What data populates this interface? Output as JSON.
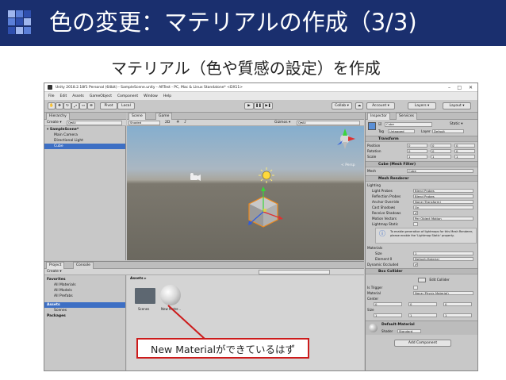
{
  "slide": {
    "title": "色の変更：マテリアルの作成（3/3)",
    "subtitle": "マテリアル（色や質感の設定）を作成",
    "callout": "New Materialができているはず"
  },
  "colors": {
    "header_bg": "#1a2f6e",
    "selection": "#3d6fc4",
    "callout_border": "#cc1b1b"
  },
  "window": {
    "title": "Unity 2018.2.18f1 Personal (64bit) - SampleScene.unity - ARTest - PC, Mac & Linux Standalone* <DX11>",
    "menu": [
      "File",
      "Edit",
      "Assets",
      "GameObject",
      "Component",
      "Window",
      "Help"
    ]
  },
  "toolbar": {
    "pivot": "Pivot",
    "local": "Local",
    "collab": "Collab ▾",
    "account": "Account ▾",
    "layers": "Layers ▾",
    "layout": "Layout ▾"
  },
  "hierarchy": {
    "tab": "Hierarchy",
    "create": "Create ▾",
    "search": "Q▾All",
    "scene": "SampleScene*",
    "items": [
      "Main Camera",
      "Directional Light",
      "Cube"
    ]
  },
  "scene": {
    "tabs": [
      "Scene",
      "Game"
    ],
    "shading": "Shaded",
    "mode2d": "2D",
    "gizmos": "Gizmos ▾",
    "search": "Q▾All",
    "persp": "< Persp"
  },
  "inspector": {
    "tabs": [
      "Inspector",
      "Services"
    ],
    "name": "Cube",
    "static_label": "Static ▾",
    "tag_label": "Tag",
    "tag_value": "Untagged",
    "layer_label": "Layer",
    "layer_value": "Default",
    "transform": {
      "title": "Transform",
      "rows": [
        {
          "label": "Position",
          "x": "0",
          "y": "0",
          "z": "0"
        },
        {
          "label": "Rotation",
          "x": "0",
          "y": "0",
          "z": "0"
        },
        {
          "label": "Scale",
          "x": "1",
          "y": "1",
          "z": "1"
        }
      ]
    },
    "mesh_filter": {
      "title": "Cube (Mesh Filter)",
      "label": "Mesh",
      "value": "Cube"
    },
    "mesh_renderer": {
      "title": "Mesh Renderer",
      "lighting": "Lighting",
      "rows": [
        {
          "label": "Light Probes",
          "value": "Blend Probes"
        },
        {
          "label": "Reflection Probes",
          "value": "Blend Probes"
        },
        {
          "label": "Anchor Override",
          "value": "None (Transform)"
        },
        {
          "label": "Cast Shadows",
          "value": "On"
        },
        {
          "label": "Receive Shadows",
          "value": "✔"
        },
        {
          "label": "Motion Vectors",
          "value": "Per Object Motion"
        },
        {
          "label": "Lightmap Static",
          "value": ""
        }
      ],
      "info": "To enable generation of lightmaps for this Mesh Renderer, please enable the 'Lightmap Static' property.",
      "materials": "Materials",
      "size_label": "Size",
      "size_value": "1",
      "element_label": "Element 0",
      "element_value": "Default-Material",
      "dynamic": "Dynamic Occluded"
    },
    "box_collider": {
      "title": "Box Collider",
      "edit": "Edit Collider",
      "is_trigger": "Is Trigger",
      "material_label": "Material",
      "material_value": "None (Physic Material)",
      "center": "Center",
      "center_xyz": [
        "0",
        "0",
        "0"
      ],
      "size": "Size",
      "size_xyz": [
        "1",
        "1",
        "1"
      ]
    },
    "material": {
      "name": "Default-Material",
      "shader_label": "Shader",
      "shader_value": "Standard"
    },
    "add_component": "Add Component"
  },
  "project": {
    "tabs": [
      "Project",
      "Console"
    ],
    "create": "Create ▾",
    "tree": [
      {
        "label": "Favorites",
        "bold": true
      },
      {
        "label": "All Materials",
        "bold": false
      },
      {
        "label": "All Models",
        "bold": false
      },
      {
        "label": "All Prefabs",
        "bold": false
      },
      {
        "label": "Assets",
        "bold": true
      },
      {
        "label": "Scenes",
        "bold": false
      },
      {
        "label": "Packages",
        "bold": true
      }
    ],
    "breadcrumb": "Assets ▸",
    "assets": [
      {
        "name": "Scenes",
        "icon": "folder-icon"
      },
      {
        "name": "New Mater...",
        "icon": "material-sphere-icon"
      }
    ]
  }
}
